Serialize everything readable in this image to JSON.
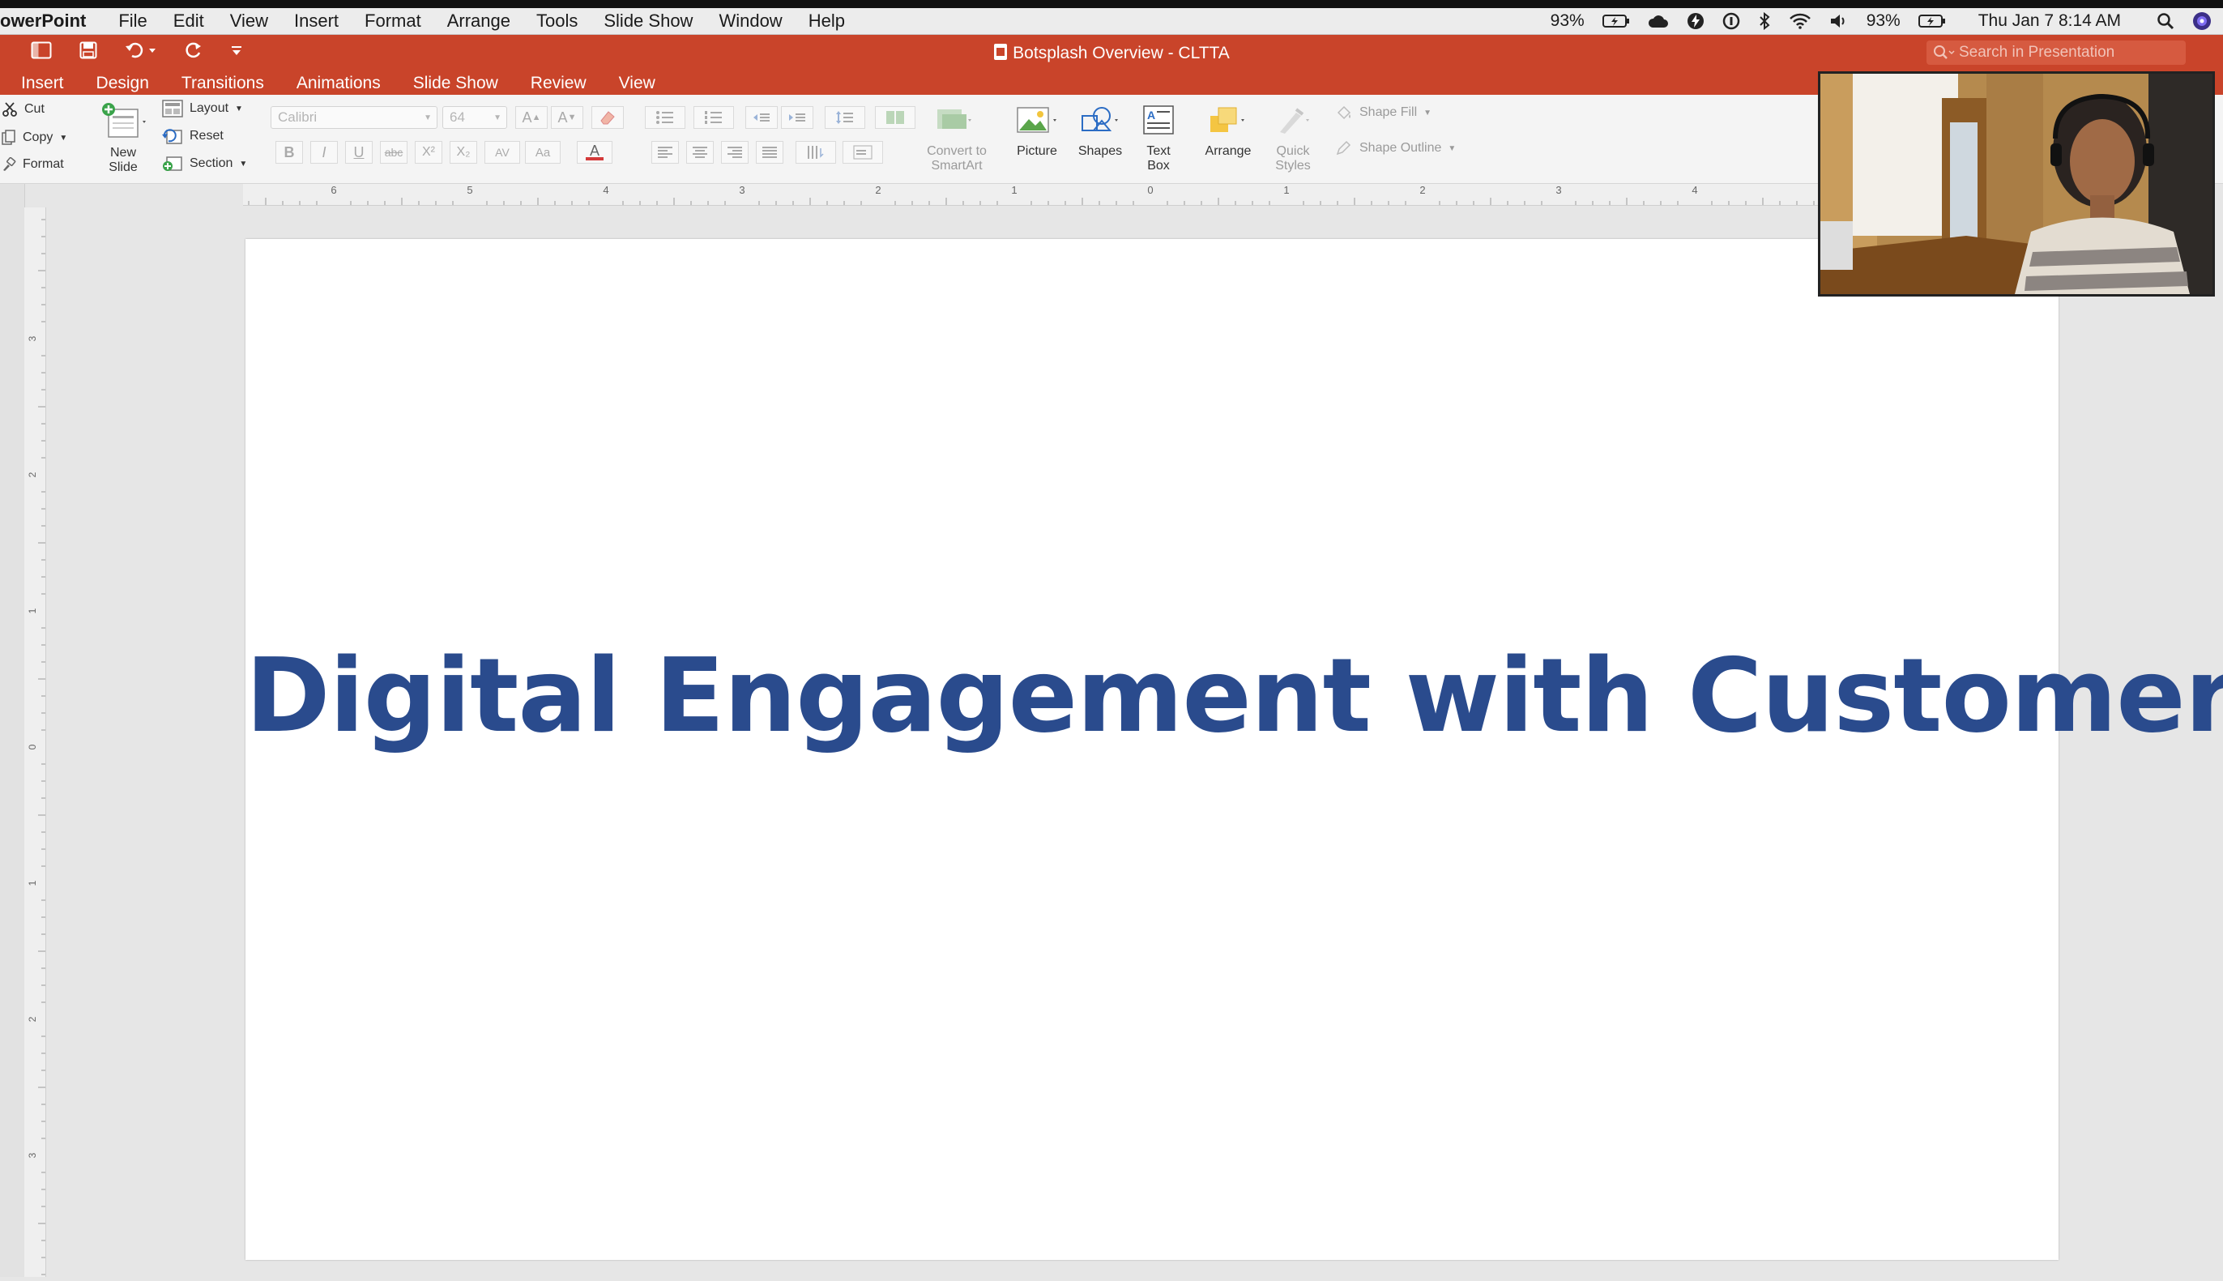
{
  "menubar": {
    "app": "owerPoint",
    "items": [
      "File",
      "Edit",
      "View",
      "Insert",
      "Format",
      "Arrange",
      "Tools",
      "Slide Show",
      "Window",
      "Help"
    ],
    "battery1": "93%",
    "battery2": "93%",
    "datetime": "Thu Jan 7  8:14 AM"
  },
  "titlebar": {
    "title": "Botsplash Overview - CLTTA",
    "search_placeholder": "Search in Presentation"
  },
  "tabs": [
    "Insert",
    "Design",
    "Transitions",
    "Animations",
    "Slide Show",
    "Review",
    "View"
  ],
  "ribbon": {
    "clipboard": {
      "cut": "Cut",
      "copy": "Copy",
      "format": "Format"
    },
    "new_slide": "New\nSlide",
    "slides": {
      "layout": "Layout",
      "reset": "Reset",
      "section": "Section"
    },
    "font_name": "Calibri",
    "font_size": "64",
    "format_buttons": {
      "bold": "B",
      "italic": "I",
      "underline": "U",
      "strike": "abc",
      "superscript": "X²",
      "subscript": "X₂",
      "spacing": "AV",
      "case": "Aa",
      "font_color": "A"
    },
    "convert_smartart": "Convert to\nSmartArt",
    "picture": "Picture",
    "shapes": "Shapes",
    "text_box": "Text\nBox",
    "arrange": "Arrange",
    "quick_styles": "Quick\nStyles",
    "shape_fill": "Shape Fill",
    "shape_outline": "Shape Outline"
  },
  "ruler": {
    "h_labels": [
      "6",
      "5",
      "4",
      "3",
      "2",
      "1",
      "0",
      "1",
      "2",
      "3",
      "4"
    ],
    "v_labels": [
      "3",
      "2",
      "1",
      "0",
      "1",
      "2",
      "3"
    ]
  },
  "slide": {
    "title": "Digital Engagement with Customers",
    "title_color": "#2a4b8d"
  },
  "colors": {
    "accent": "#c9442a",
    "menubar": "#ececec",
    "ribbon": "#f4f4f4"
  }
}
